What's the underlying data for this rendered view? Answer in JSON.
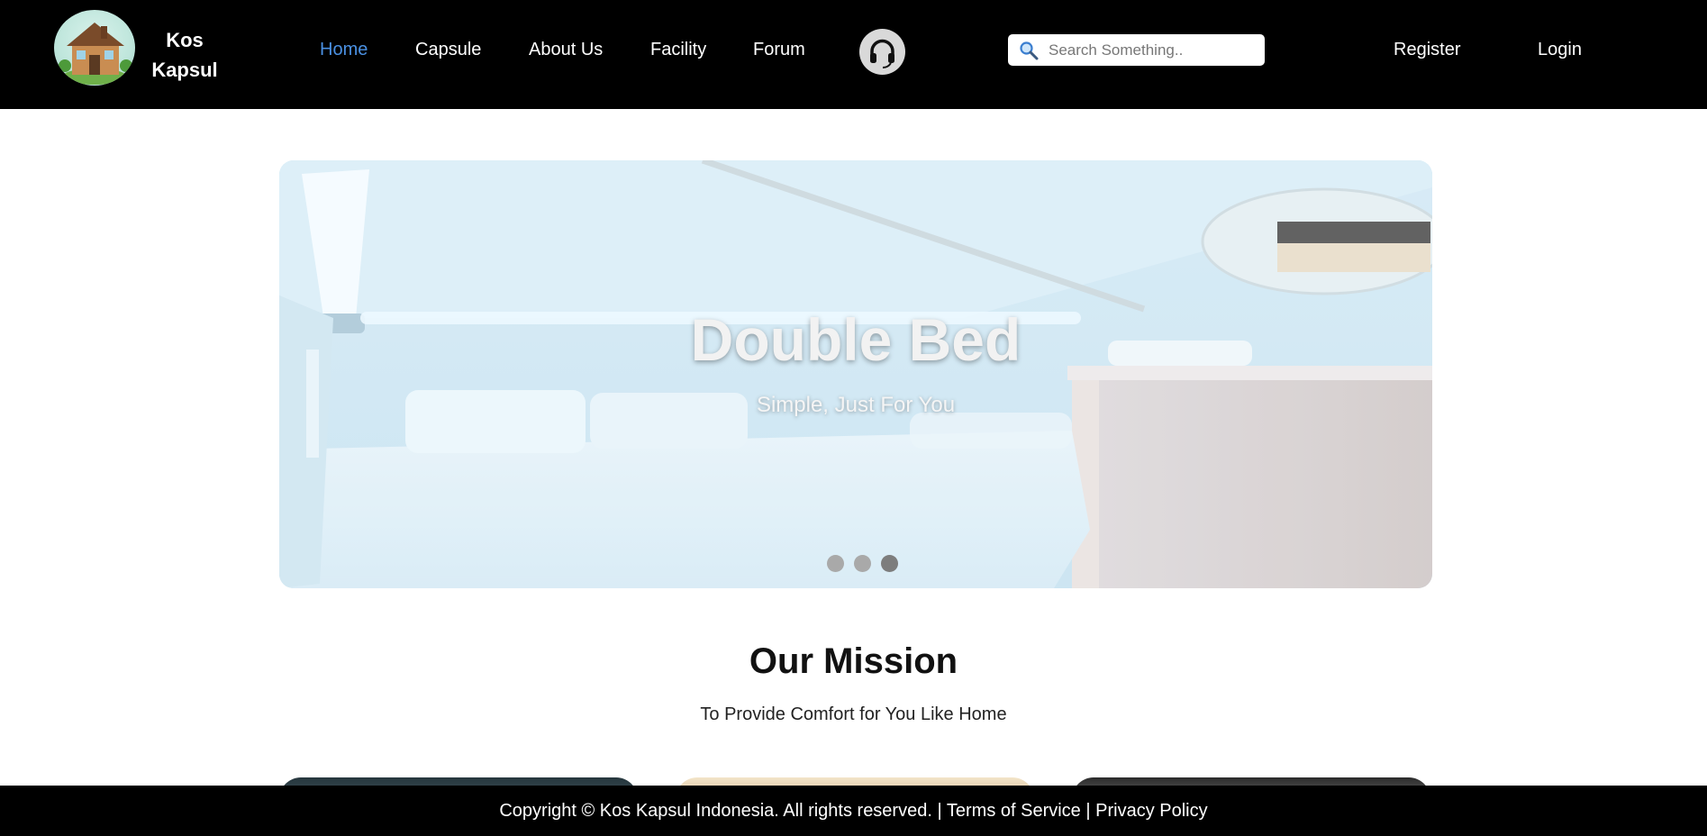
{
  "brand": {
    "name_line1": "Kos",
    "name_line2": "Kapsul"
  },
  "nav": {
    "items": [
      {
        "label": "Home",
        "active": true
      },
      {
        "label": "Capsule",
        "active": false
      },
      {
        "label": "About Us",
        "active": false
      },
      {
        "label": "Facility",
        "active": false
      },
      {
        "label": "Forum",
        "active": false
      }
    ],
    "active_color": "#4a90e2"
  },
  "support": {
    "icon": "headset-icon"
  },
  "search": {
    "placeholder": "Search Something..",
    "value": "",
    "icon": "search-icon"
  },
  "auth": {
    "register_label": "Register",
    "login_label": "Login"
  },
  "hero": {
    "title": "Double Bed",
    "subtitle": "Simple, Just For You",
    "slide_count": 3,
    "active_slide": 3
  },
  "mission": {
    "title": "Our Mission",
    "subtitle": "To Provide Comfort for You Like Home"
  },
  "footer": {
    "copyright": "Copyright © Kos Kapsul Indonesia. All rights reserved.",
    "separator": "|",
    "terms_label": "Terms of Service",
    "privacy_label": "Privacy Policy"
  },
  "colors": {
    "header_bg": "#000000",
    "footer_bg": "#000000",
    "page_bg": "#ffffff"
  }
}
